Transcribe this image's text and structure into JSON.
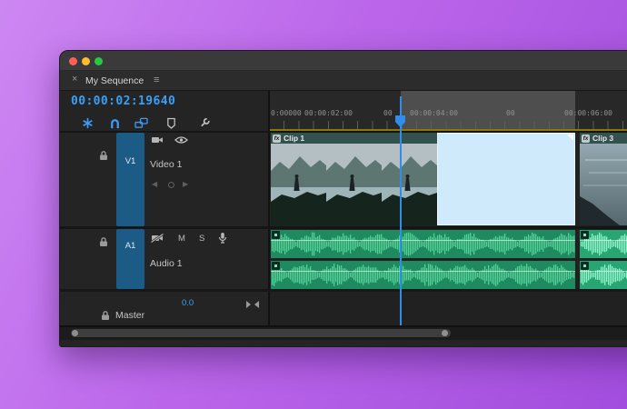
{
  "colors": {
    "accent_blue": "#3f9bfa",
    "playhead_blue": "#2f8dec",
    "selected_clip": "#cfeafb",
    "audio_clip": "#1f8a60",
    "audio_clip_bright": "#29a473",
    "waveform_main": "#54d096",
    "waveform_bright": "#8ef3c7",
    "traffic_red": "#ff5f57",
    "traffic_yellow": "#febc2e",
    "traffic_green": "#28c840"
  },
  "panel_tab": {
    "close": "×",
    "title": "My Sequence",
    "menu": "≡"
  },
  "timecode": "00:00:02:19640",
  "toolbar": {
    "icons": [
      "nest",
      "snap-magnet",
      "linked-selection",
      "add-marker",
      "timeline-settings-wrench"
    ]
  },
  "ruler": {
    "labels": [
      {
        "text": "0:00000"
      },
      {
        "text": "00:00:02:00"
      },
      {
        "text": "00"
      },
      {
        "text": "00:00:04:00"
      },
      {
        "text": "00"
      },
      {
        "text": "00:00:06:00"
      }
    ]
  },
  "tracks": {
    "video1": {
      "target": "V1",
      "name": "Video 1"
    },
    "audio1": {
      "target": "A1",
      "name": "Audio 1",
      "mute": "M",
      "solo": "S"
    },
    "master": {
      "name": "Master",
      "gain": "0.0"
    }
  },
  "clips": {
    "video": [
      {
        "label": "Clip 1",
        "fx": "fx"
      },
      {
        "label": ""
      },
      {
        "label": "Clip 3",
        "fx": "fx"
      }
    ]
  }
}
